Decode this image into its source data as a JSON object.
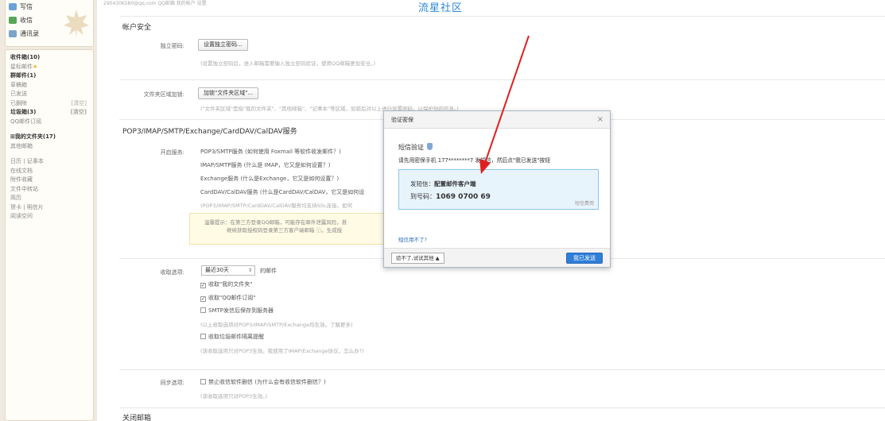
{
  "sidebar": {
    "compose": [
      {
        "label": "写信"
      },
      {
        "label": "收信"
      },
      {
        "label": "通讯录"
      }
    ],
    "folders": [
      {
        "label": "收件箱(10)",
        "bold": true
      },
      {
        "label": "星标邮件",
        "star": "★"
      },
      {
        "label": "群邮件(1)",
        "bold": true
      },
      {
        "label": "草稿箱"
      },
      {
        "label": "已发送"
      },
      {
        "label": "已删除",
        "clear": "[清空]"
      },
      {
        "label": "垃圾箱(3)",
        "bold": true,
        "clear": "[清空]"
      },
      {
        "label": "QQ邮件订阅"
      },
      {
        "gap": true
      },
      {
        "label": "⊞我的文件夹(17)",
        "bold": true
      },
      {
        "label": "其他邮箱"
      },
      {
        "gap": true
      },
      {
        "label": "日历 | 记事本"
      },
      {
        "label": "在线文档"
      },
      {
        "label": "附件收藏"
      },
      {
        "label": "文件中转站"
      },
      {
        "label": "简历"
      },
      {
        "label": "贺卡 | 明信片"
      },
      {
        "label": "阅读空间"
      }
    ]
  },
  "top": {
    "strip": "2904306580@qq.com        QQ邮箱        我的帐户  设置",
    "watermark": "流星社区"
  },
  "account_security": {
    "title": "帐户安全",
    "pwd_label": "独立密码:",
    "pwd_button": "设置独立密码...",
    "pwd_hint": "(设置独立密码后，进入邮箱需要输入独立密码验证，使用QQ邮箱更加安全。)",
    "folder_label": "文件夹区域加锁:",
    "folder_button": "加锁\"文件夹区域\"...",
    "folder_hint": "(\"文件夹区域\"是指\"我的文件夹\"、\"其他邮箱\"、\"记事本\"等区域，加锁后对以上进行设置密码，以保护你的信息。)"
  },
  "pop3": {
    "title": "POP3/IMAP/SMTP/Exchange/CardDAV/CalDAV服务",
    "label": "开启服务:",
    "services": [
      "POP3/SMTP服务 (如何使用 Foxmail 等软件收发邮件？)",
      "IMAP/SMTP服务 (什么是 IMAP，它又是如何设置？)",
      "Exchange服务 (什么是Exchange，它又是如何设置？)",
      "CardDAV/CalDAV服务 (什么是CardDAV/CalDAV，它又是如何设"
    ],
    "ssl_hint": "(POP3/IMAP/SMTP/CardDAV/CalDAV服务均支持SSL连接。如何",
    "warn1": "温馨提示：在第三方登录QQ邮箱，可能存在邮件泄露风险，甚",
    "warn2": "继续获取授权码登录第三方客户端邮箱 ⓘ。生成授"
  },
  "receive": {
    "label": "收取选项:",
    "select": "最近30天",
    "select_suffix": "的邮件",
    "opt1": "收取\"我的文件夹\"",
    "opt2": "收取\"QQ邮件订阅\"",
    "opt3": "SMTP发信后保存到服务器",
    "hint1": "(以上收取选项对POP3/IMAP/SMTP/Exchange均生效。了解更多)",
    "opt4": "收取垃圾邮件隔离提醒",
    "hint2": "(该收取选项只对POP3生效。我使用了IMAP/Exchange协议，怎么办?)"
  },
  "sync": {
    "label": "同步选项:",
    "opt": "禁止收信软件删信 (为什么会有收信软件删信？)",
    "hint": "(该收取选项只对POP3生效。)"
  },
  "close_mailbox": {
    "title": "关闭邮箱"
  },
  "dialog": {
    "title": "验证密保",
    "close": "×",
    "sms_title": "短信验证",
    "sms_desc": "请先用密保手机 177********7 发短信，然后点\"我已发送\"按钮",
    "send_label": "发短信：",
    "send_value": "配置邮件客户端",
    "to_label": "到号码：",
    "to_value": "1069 0700 69",
    "fee": "短信费用",
    "cant_sms": "短信用不了?",
    "other_button": "验不了,试试其他 ▲",
    "sent_button": "我已发送"
  },
  "colors": {
    "arrow": "#e02020",
    "primary": "#2f7ed8",
    "sidebar_bg": "#efe9df"
  }
}
